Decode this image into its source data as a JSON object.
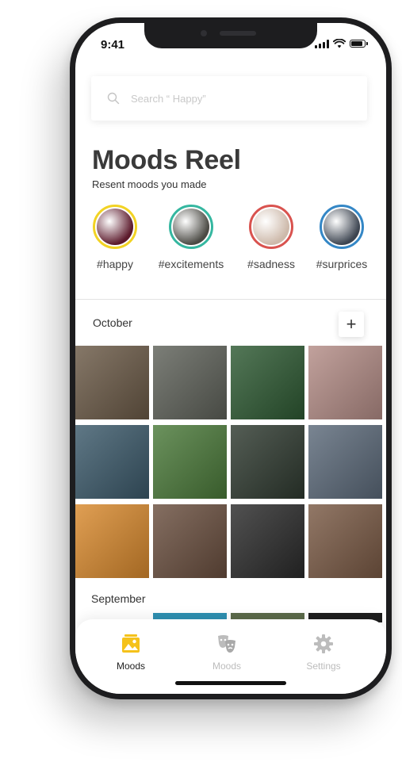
{
  "status": {
    "time": "9:41"
  },
  "search": {
    "placeholder": "Search “ Happy”"
  },
  "header": {
    "title": "Moods Reel",
    "subtitle": "Resent moods you made"
  },
  "stories": [
    {
      "tag": "#happy",
      "ring": "#f2d324",
      "fill": "#5c1a2c"
    },
    {
      "tag": "#excitements",
      "ring": "#35b7a0",
      "fill": "#4b4a44"
    },
    {
      "tag": "#sadness",
      "ring": "#d9534f",
      "fill": "#cdb9aa"
    },
    {
      "tag": "#surprices",
      "ring": "#3487c6",
      "fill": "#3d4551"
    }
  ],
  "sections": [
    {
      "month": "October"
    },
    {
      "month": "September"
    }
  ],
  "add_label": "+",
  "photos": [
    "#6b5a47",
    "#5f625a",
    "#2e5a33",
    "#b48d87",
    "#3c5a6b",
    "#4b7a3a",
    "#2f3a30",
    "#5c6a7a",
    "#d98a2e",
    "#6a4f3f",
    "#2b2b2b",
    "#7a5a45"
  ],
  "peek_photos": [
    "#2e8fb0",
    "#5b6a4a",
    "#1e1e1e"
  ],
  "tabs": [
    {
      "label": "Moods",
      "icon": "photo-icon",
      "active": true
    },
    {
      "label": "Moods",
      "icon": "masks-icon",
      "active": false
    },
    {
      "label": "Settings",
      "icon": "gear-icon",
      "active": false
    }
  ],
  "colors": {
    "accent": "#f5c21b",
    "inactive": "#bcbcbc",
    "active_text": "#222222"
  }
}
